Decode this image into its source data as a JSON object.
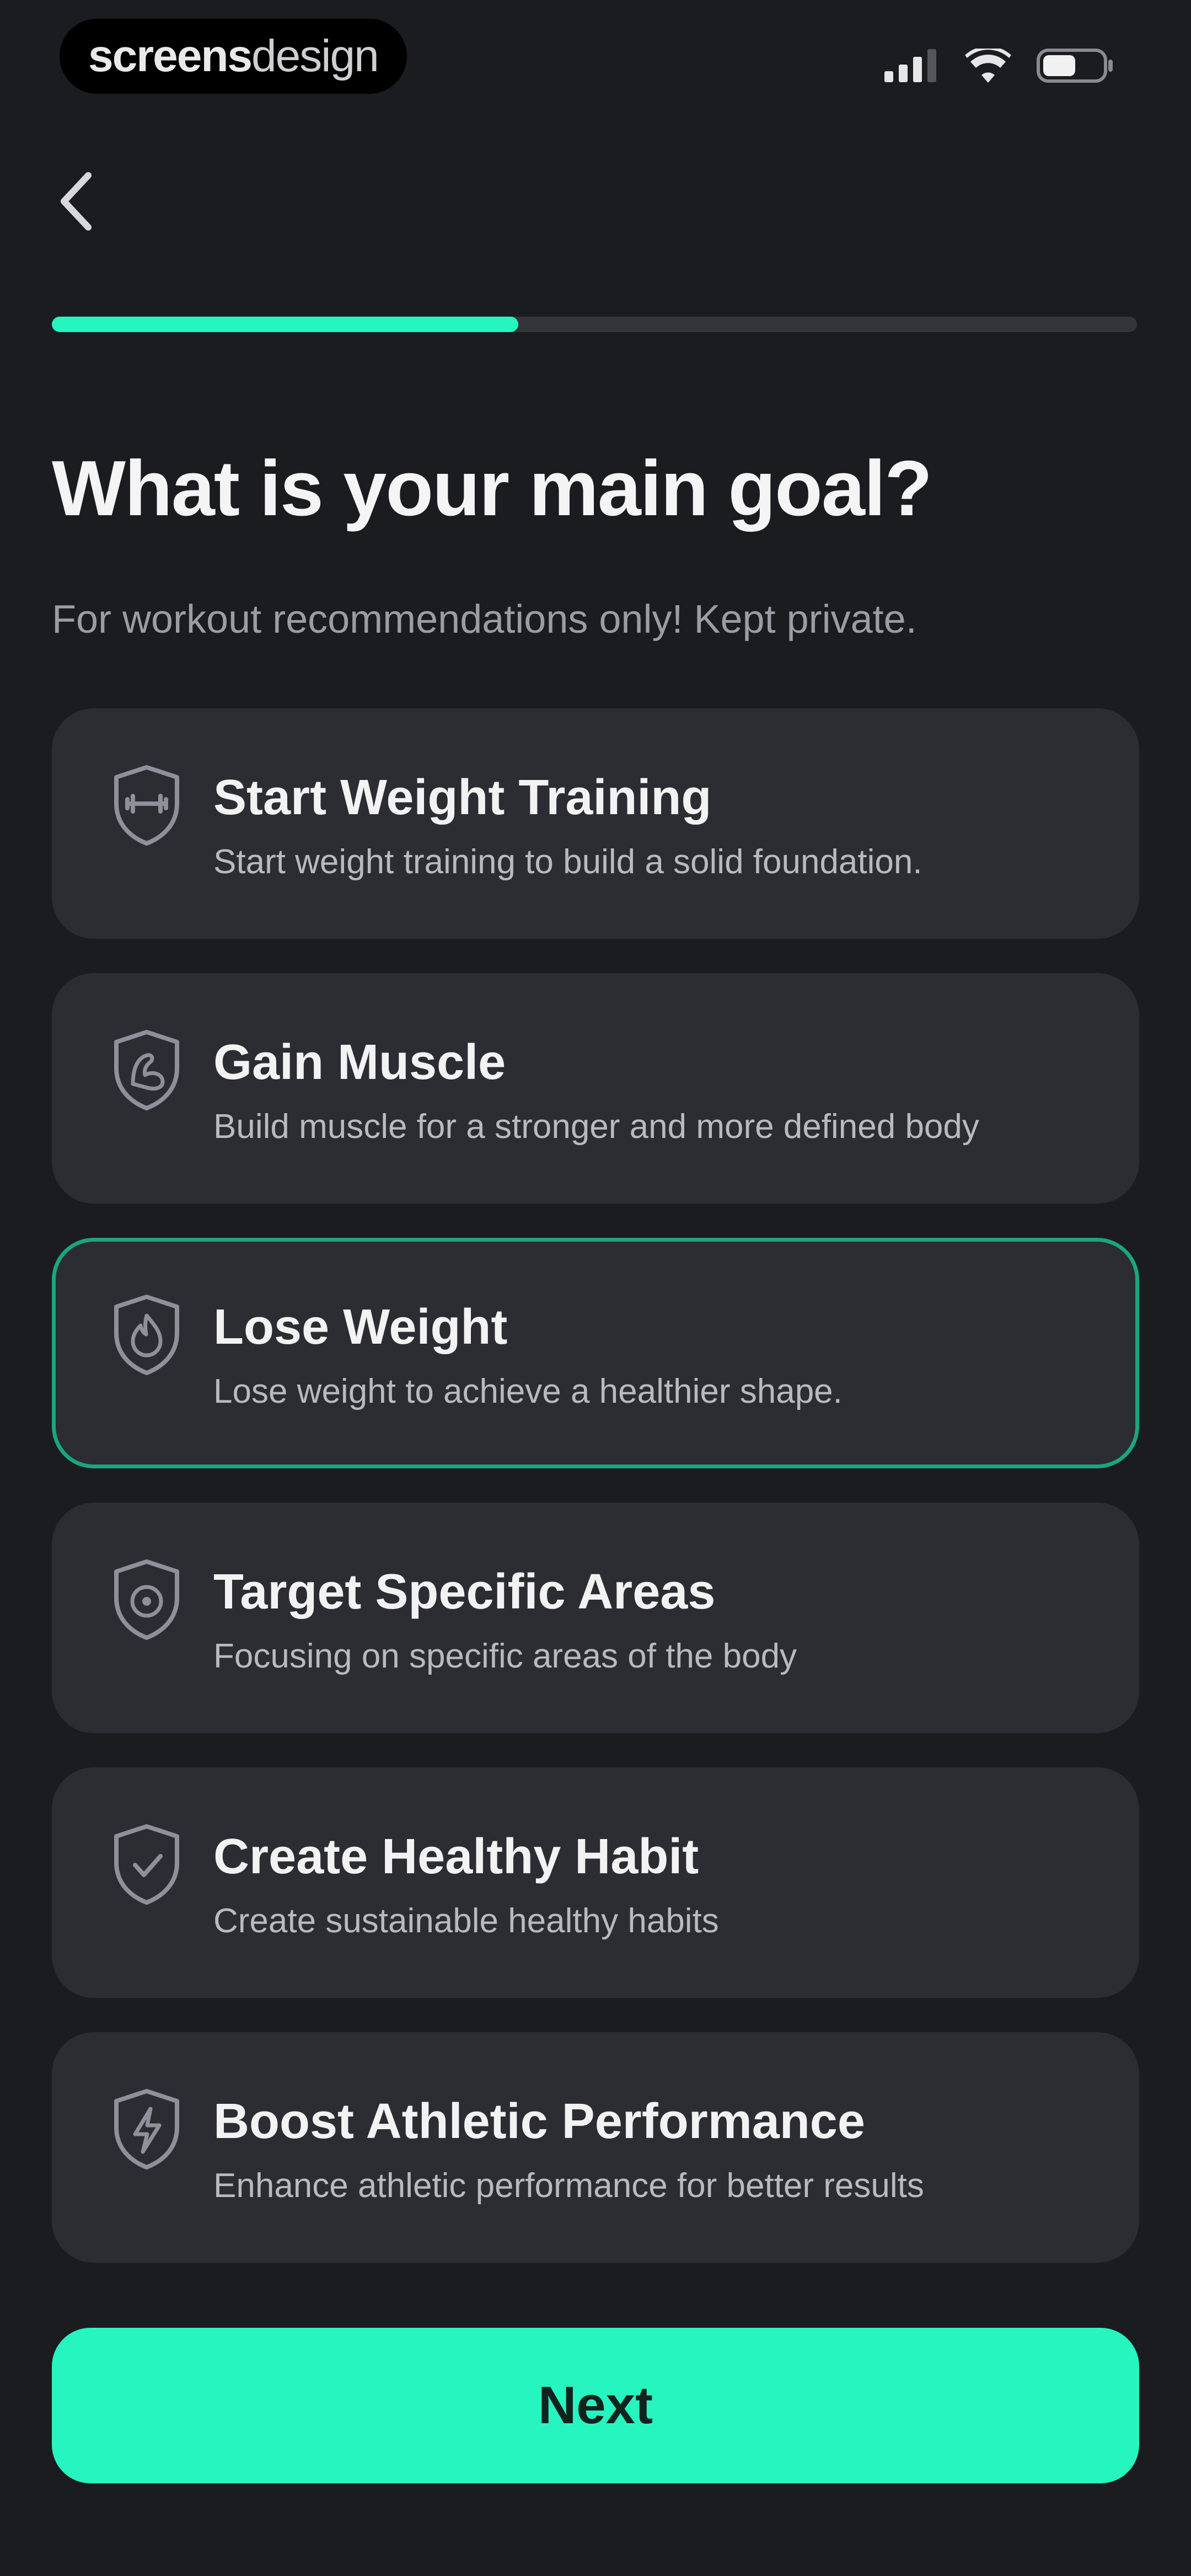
{
  "status_bar": {
    "brand_bold": "screens",
    "brand_light": "design"
  },
  "progress": {
    "fraction": 0.43,
    "accent_color": "#27f5c0"
  },
  "page": {
    "title": "What is your main goal?",
    "subtitle": "For workout recommendations only! Kept private."
  },
  "options": [
    {
      "title": "Start Weight Training",
      "description": "Start weight training to build a solid foundation.",
      "icon": "shield-dumbbell-icon",
      "selected": false
    },
    {
      "title": "Gain Muscle",
      "description": "Build muscle for a stronger and more defined body",
      "icon": "shield-muscle-icon",
      "selected": false
    },
    {
      "title": "Lose Weight",
      "description": "Lose weight to achieve a healthier shape.",
      "icon": "shield-flame-icon",
      "selected": true
    },
    {
      "title": "Target Specific Areas",
      "description": "Focusing on specific areas of the body",
      "icon": "shield-target-icon",
      "selected": false
    },
    {
      "title": "Create Healthy Habit",
      "description": "Create sustainable healthy habits",
      "icon": "shield-habit-icon",
      "selected": false
    },
    {
      "title": "Boost Athletic Performance",
      "description": "Enhance athletic performance for better results",
      "icon": "shield-bolt-icon",
      "selected": false
    }
  ],
  "footer": {
    "next_label": "Next"
  }
}
